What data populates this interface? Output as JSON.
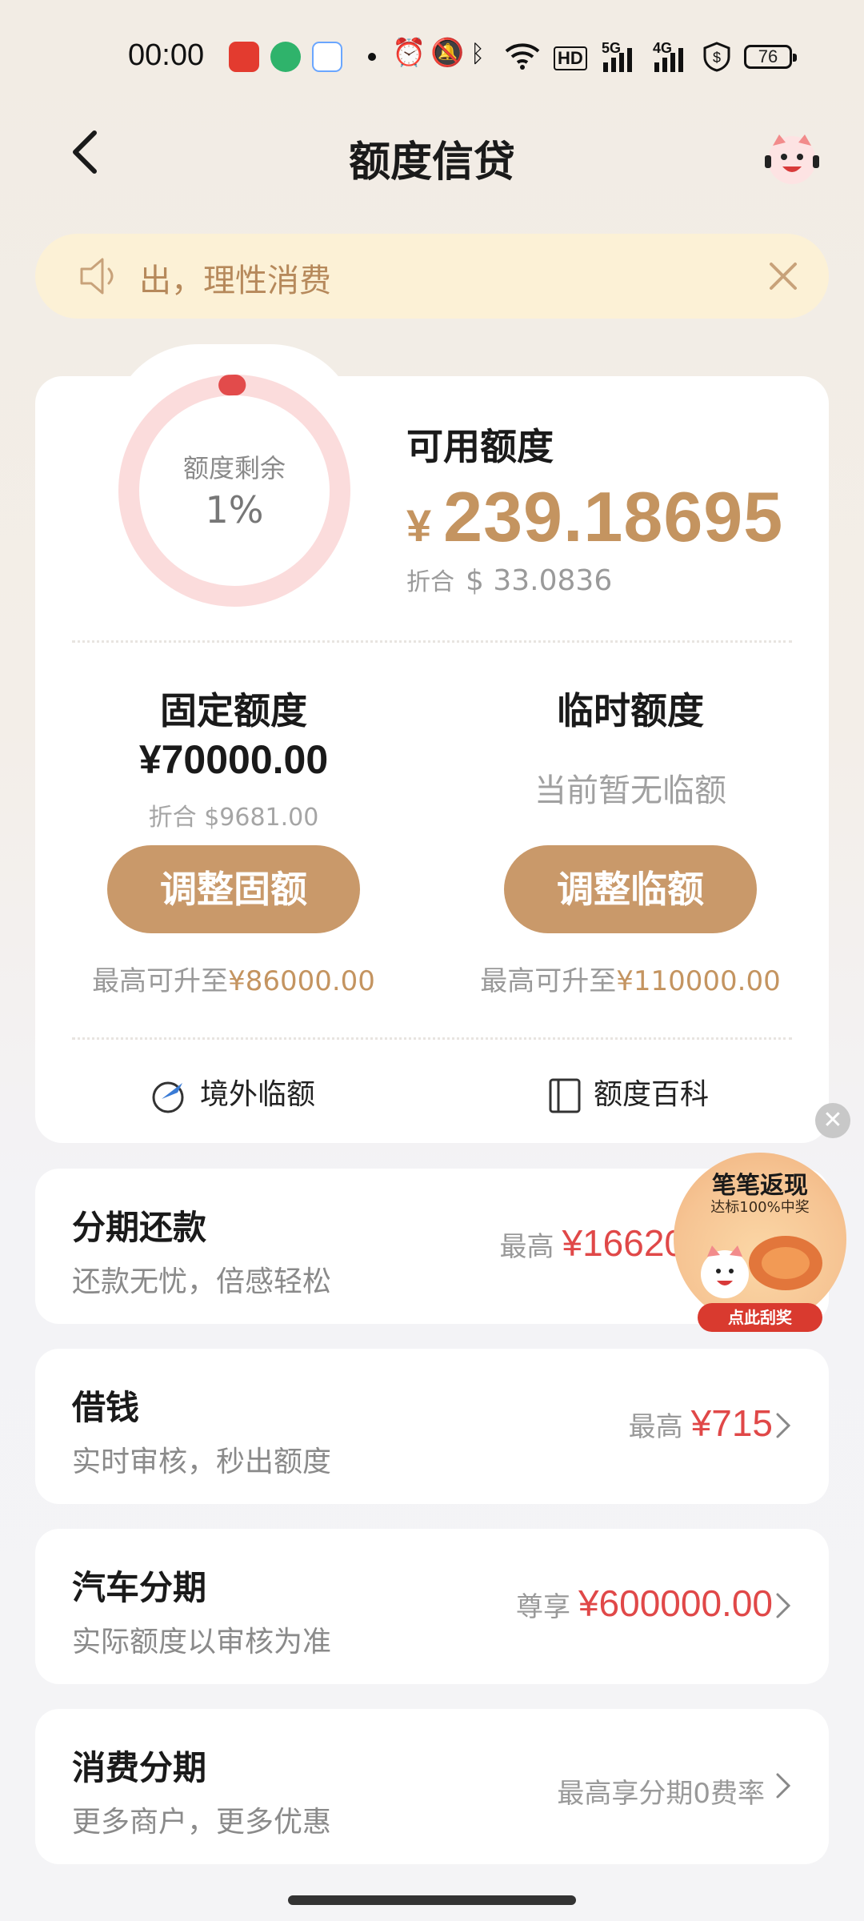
{
  "status_bar": {
    "time": "00:00",
    "hd_label": "HD",
    "signal_1": "5G",
    "signal_2": "4G",
    "battery": "76"
  },
  "header": {
    "title": "额度信贷"
  },
  "notice": {
    "text": "出，理性消费"
  },
  "credit": {
    "ring_label": "额度剩余",
    "ring_percent_text": "1%",
    "ring_fraction": 0.01,
    "available_title": "可用额度",
    "currency_symbol": "¥",
    "available_amount": "239.18695",
    "usd_prefix": "折合",
    "available_usd": "$ 33.0836"
  },
  "fixed": {
    "title": "固定额度",
    "amount": "¥70000.00",
    "usd": "折合 $9681.00",
    "button": "调整固额",
    "max_prefix": "最高可升至",
    "max_amount": "¥86000.00"
  },
  "temporary": {
    "title": "临时额度",
    "none_text": "当前暂无临额",
    "button": "调整临额",
    "max_prefix": "最高可升至",
    "max_amount": "¥110000.00"
  },
  "links": {
    "overseas": "境外临额",
    "encyclopedia": "额度百科"
  },
  "list": [
    {
      "title": "分期还款",
      "sub": "还款无忧，倍感轻松",
      "prefix": "最高",
      "value": "¥16620"
    },
    {
      "title": "借钱",
      "sub": "实时审核，秒出额度",
      "prefix": "最高",
      "value": "¥715"
    },
    {
      "title": "汽车分期",
      "sub": "实际额度以审核为准",
      "prefix": "尊享",
      "value": "¥600000.00"
    },
    {
      "title": "消费分期",
      "sub": "更多商户，更多优惠",
      "prefix": "最高享分期0费率",
      "value": ""
    }
  ],
  "promo": {
    "title": "笔笔返现",
    "sub": "达标100%中奖",
    "button": "点此刮奖"
  },
  "colors": {
    "accent_gold": "#c49460",
    "button_gold": "#c9996a",
    "highlight_red": "#e04848",
    "notice_bg": "#fcf1d6"
  }
}
